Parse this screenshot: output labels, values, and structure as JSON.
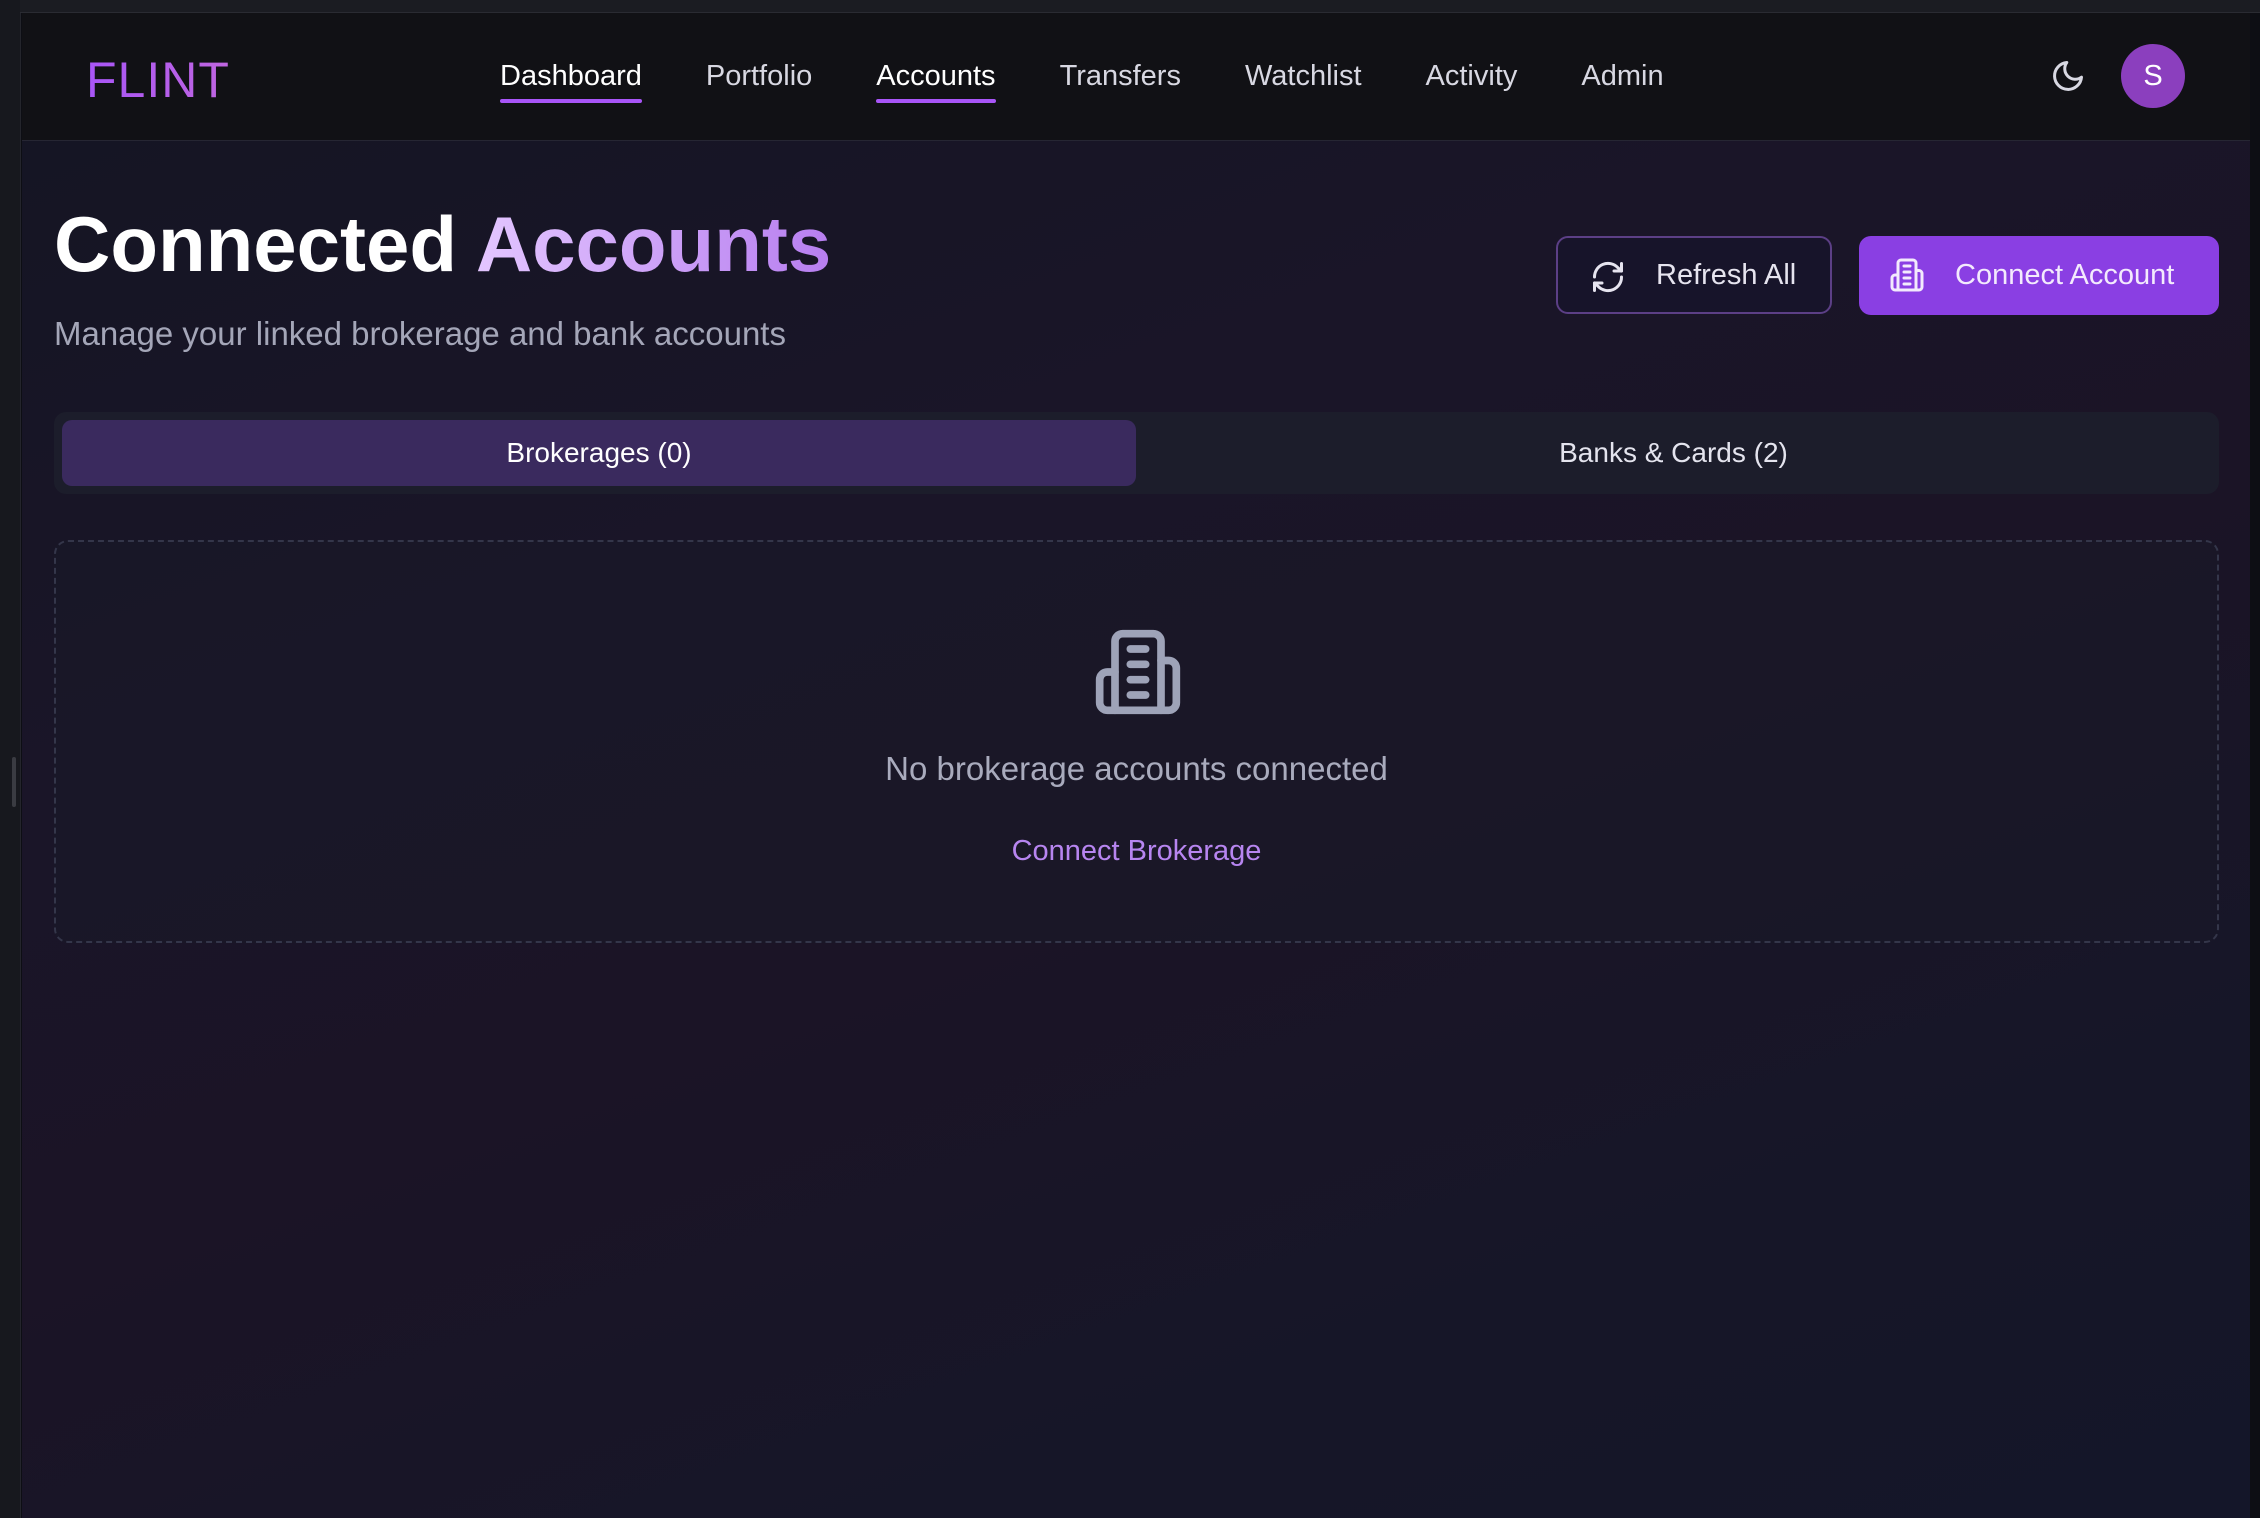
{
  "app": {
    "brand": "FLINT",
    "brand_color": "#a855f7"
  },
  "nav": {
    "items": [
      {
        "label": "Dashboard",
        "active": true
      },
      {
        "label": "Portfolio",
        "active": false
      },
      {
        "label": "Accounts",
        "active": true
      },
      {
        "label": "Transfers",
        "active": false
      },
      {
        "label": "Watchlist",
        "active": false
      },
      {
        "label": "Activity",
        "active": false
      },
      {
        "label": "Admin",
        "active": false
      }
    ],
    "theme_icon": "moon-icon",
    "avatar_initial": "S",
    "avatar_color": "#8b3fbe"
  },
  "header": {
    "title_main": "Connected",
    "title_accent": "Accounts",
    "subtitle": "Manage your linked brokerage and bank accounts",
    "refresh_label": "Refresh All",
    "refresh_icon": "refresh-icon",
    "connect_label": "Connect Account",
    "connect_icon": "building-icon",
    "accent_color": "#8a3fe3"
  },
  "tabs": [
    {
      "label": "Brokerages (0)",
      "selected": true
    },
    {
      "label": "Banks & Cards (2)",
      "selected": false
    }
  ],
  "empty_state": {
    "icon": "building-icon",
    "message": "No brokerage accounts connected",
    "action_label": "Connect Brokerage"
  }
}
